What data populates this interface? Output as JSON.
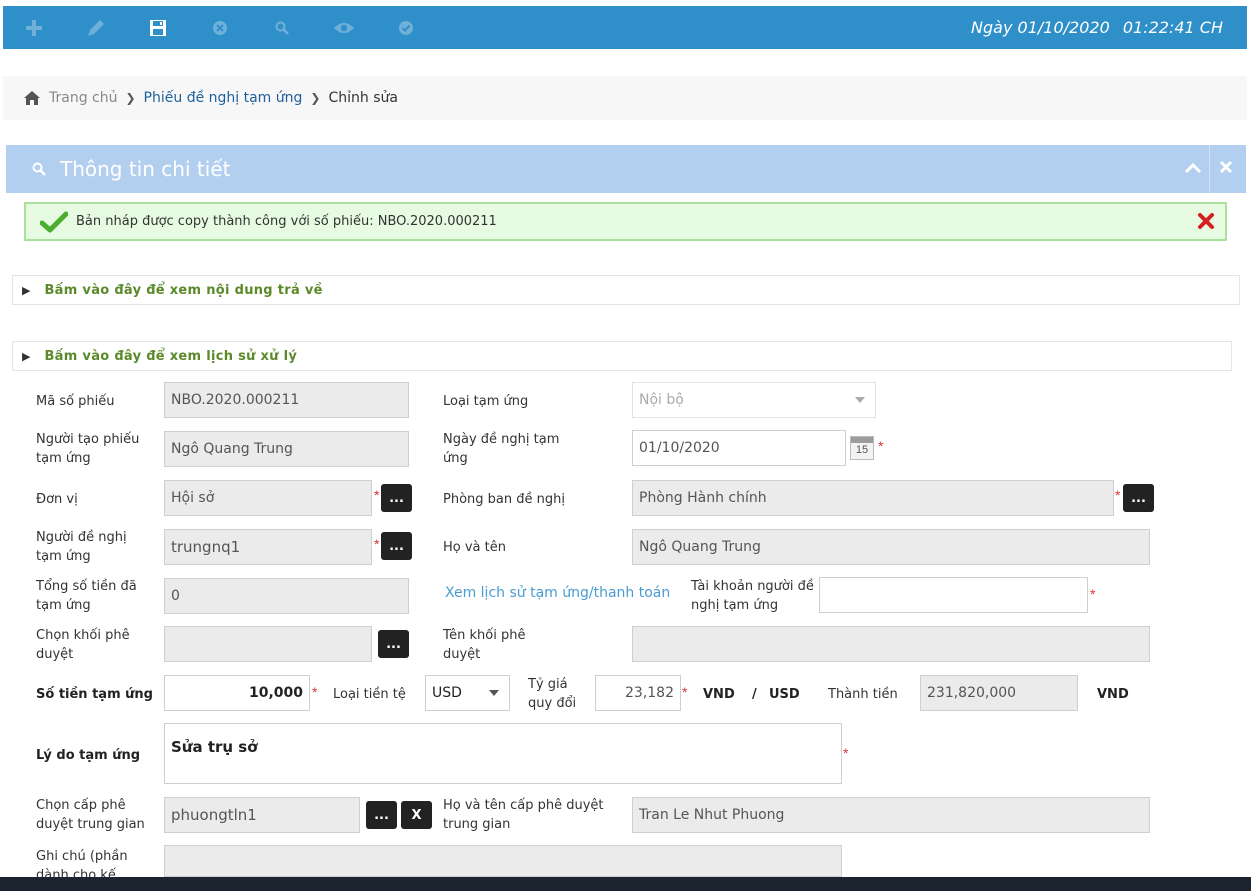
{
  "toolbar": {
    "icons": [
      "plus-icon",
      "pencil-icon",
      "save-icon",
      "cancel-icon",
      "search-icon",
      "eye-icon",
      "check-icon"
    ],
    "date_label": "Ngày 01/10/2020",
    "time_label": "01:22:41 CH"
  },
  "breadcrumb": {
    "home": "Trang chủ",
    "link": "Phiếu đề nghị tạm ứng",
    "current": "Chỉnh sửa"
  },
  "panel": {
    "title": "Thông tin chi tiết"
  },
  "alert": {
    "message": "Bản nháp được copy thành công với số phiếu: NBO.2020.000211"
  },
  "collapsibles": {
    "returned": "Bấm vào đây để xem nội dung trả về",
    "history": "Bấm vào đây để xem lịch sử xử lý"
  },
  "form": {
    "ma_so_phieu": {
      "label": "Mã số phiếu",
      "value": "NBO.2020.000211"
    },
    "loai_tam_ung": {
      "label": "Loại tạm ứng",
      "value": "Nội bộ"
    },
    "nguoi_tao": {
      "label": "Người tạo phiếu tạm ứng",
      "value": "Ngô Quang Trung"
    },
    "ngay_de_nghi": {
      "label": "Ngày đề nghị tạm ứng",
      "value": "01/10/2020",
      "calendar_day": "15"
    },
    "don_vi": {
      "label": "Đơn vị",
      "value": "Hội sở"
    },
    "phong_ban": {
      "label": "Phòng ban đề nghị",
      "value": "Phòng Hành chính"
    },
    "nguoi_de_nghi": {
      "label": "Người đề nghị tạm ứng",
      "value": "trungnq1"
    },
    "ho_va_ten": {
      "label": "Họ và tên",
      "value": "Ngô Quang Trung"
    },
    "tong_so_tien": {
      "label": "Tổng số tiền đã tạm ứng",
      "value": "0"
    },
    "history_link": "Xem lịch sử tạm ứng/thanh toán",
    "tai_khoan": {
      "label": "Tài khoản người đề nghị tạm ứng",
      "value": ""
    },
    "chon_khoi": {
      "label": "Chọn khối phê duyệt",
      "value": ""
    },
    "ten_khoi": {
      "label": "Tên khối phê duyệt",
      "value": ""
    },
    "so_tien": {
      "label": "Số tiền tạm ứng",
      "value": "10,000"
    },
    "loai_tien_te": {
      "label": "Loại tiền tệ",
      "value": "USD"
    },
    "ty_gia": {
      "label": "Tỷ giá quy đổi",
      "value": "23,182"
    },
    "rate_unit_vnd": "VND",
    "rate_unit_sep": "/",
    "rate_unit_usd": "USD",
    "thanh_tien": {
      "label": "Thành tiền",
      "value": "231,820,000",
      "unit": "VND"
    },
    "ly_do": {
      "label": "Lý do tạm ứng",
      "value": "Sửa trụ sở"
    },
    "chon_cap": {
      "label": "Chọn cấp phê duyệt trung gian",
      "value": "phuongtln1"
    },
    "ho_ten_cap": {
      "label": "Họ và tên cấp phê duyệt trung gian",
      "value": "Tran Le Nhut Phuong"
    },
    "ghi_chu": {
      "label": "Ghi chú (phần dành cho kế",
      "value": ""
    },
    "required_mark": "*",
    "dots_label": "...",
    "clear_label": "X"
  },
  "colors": {
    "toolbar_bg": "#2e8fc9",
    "panel_head_bg": "#b3cff0",
    "alert_bg": "#e6fbe1",
    "accent_green": "#5b8a2a",
    "required_red": "#dd3333",
    "link_blue": "#4a9bd1"
  }
}
